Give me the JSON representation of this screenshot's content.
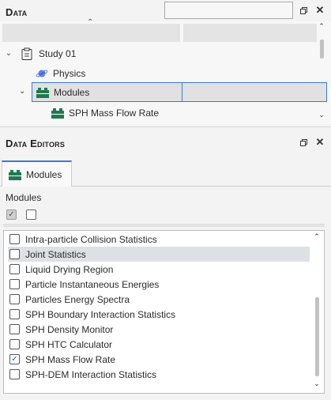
{
  "data_panel": {
    "title": "Data",
    "search_value": "",
    "tree": {
      "study": "Study 01",
      "physics": "Physics",
      "modules": "Modules",
      "module_child": "SPH Mass Flow Rate"
    }
  },
  "editors_panel": {
    "title": "Data Editors",
    "tab_label": "Modules",
    "section_label": "Modules",
    "modules": [
      {
        "label": "Intra-particle Collision Statistics",
        "checked": false
      },
      {
        "label": "Joint Statistics",
        "checked": false
      },
      {
        "label": "Liquid Drying Region",
        "checked": false
      },
      {
        "label": "Particle Instantaneous Energies",
        "checked": false
      },
      {
        "label": "Particles Energy Spectra",
        "checked": false
      },
      {
        "label": "SPH Boundary Interaction Statistics",
        "checked": false
      },
      {
        "label": "SPH Density Monitor",
        "checked": false
      },
      {
        "label": "SPH HTC Calculator",
        "checked": false
      },
      {
        "label": "SPH Mass Flow Rate",
        "checked": true
      },
      {
        "label": "SPH-DEM Interaction Statistics",
        "checked": false
      }
    ]
  },
  "icons": {
    "float": "restore-icon",
    "close": "close-icon",
    "check": "✓"
  },
  "colors": {
    "accent": "#3a7bd5",
    "module_icon": "#1f7a4d",
    "physics_icon": "#4a6fd0"
  }
}
